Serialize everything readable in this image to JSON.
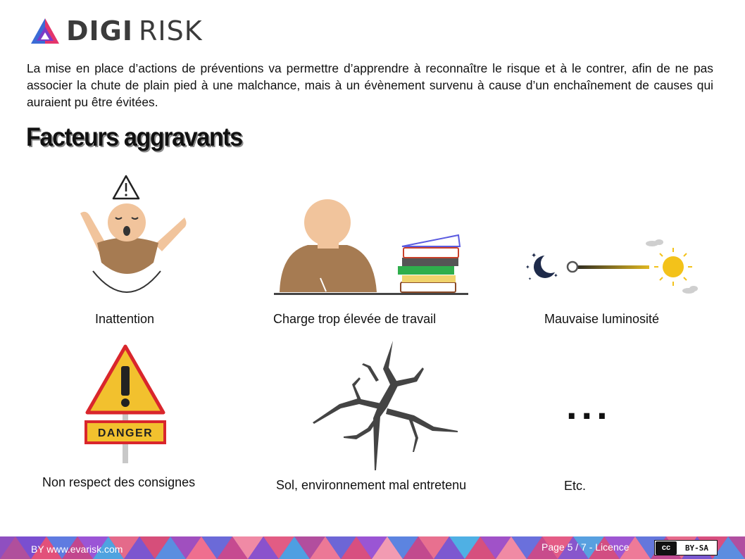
{
  "logo": {
    "part1": "DIGI",
    "part2": "RISK"
  },
  "intro": "La mise en place d’actions de préventions va permettre d’apprendre à reconnaître le risque et à le contrer, afin de ne pas associer la chute de plain pied à une malchance, mais à un évènement survenu à cause d’un enchaînement de causes qui auraient pu être évitées.",
  "heading": "Facteurs aggravants",
  "items": [
    {
      "label": "Inattention",
      "icon": "yawning-person-icon"
    },
    {
      "label": "Charge trop élevée de travail",
      "icon": "person-with-books-icon"
    },
    {
      "label": "Mauvaise luminosité",
      "icon": "moon-sun-slider-icon"
    },
    {
      "label": "Non respect des consignes",
      "icon": "danger-sign-icon"
    },
    {
      "label": "Sol, environnement mal entretenu",
      "icon": "cracked-floor-icon"
    },
    {
      "label": "Etc.",
      "icon": "ellipsis-icon"
    }
  ],
  "ellipsis": "...",
  "danger_text": "DANGER",
  "footer": {
    "by": "BY www.evarisk.com",
    "page": "Page 5 / 7 - Licence",
    "cc_left": "cc",
    "cc_right": "BY-SA"
  },
  "colors": {
    "text": "#111111",
    "skin": "#F1C49C",
    "shirt": "#A67B52",
    "danger_yellow": "#F2C12E",
    "danger_red": "#D9262C",
    "crack": "#444444",
    "sun": "#F3C21A",
    "moon": "#1E2A4A"
  }
}
